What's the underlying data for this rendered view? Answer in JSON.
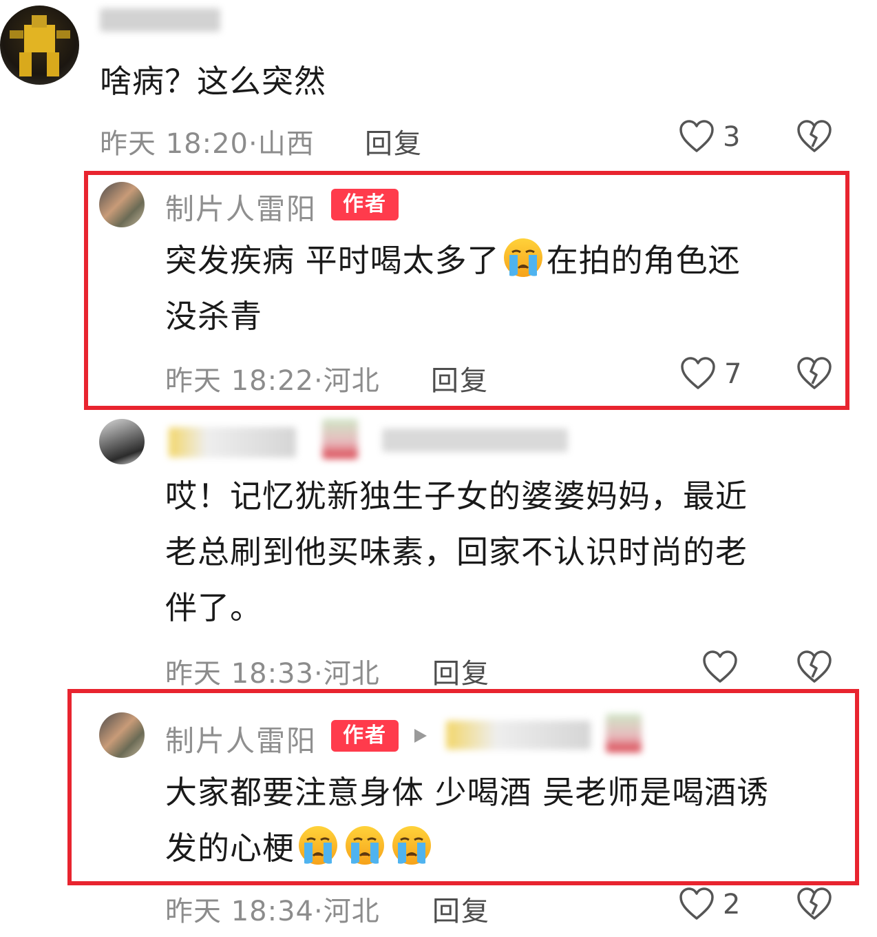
{
  "comments": [
    {
      "text": "啥病？这么突然",
      "time": "昨天 18:20",
      "location": "山西",
      "reply": "回复",
      "likes": "3"
    },
    {
      "username": "制片人雷阳",
      "badge": "作者",
      "text_line1": "突发疾病 平时喝太多了",
      "text_line1b": "在拍的角色还",
      "text_line2": "没杀青",
      "time": "昨天 18:22",
      "location": "河北",
      "reply": "回复",
      "likes": "7"
    },
    {
      "text_line1": "哎！记忆犹新独生子女的婆婆妈妈，最近",
      "text_line2": "老总刷到他买味素，回家不认识时尚的老",
      "text_line3": "伴了。",
      "time": "昨天 18:33",
      "location": "河北",
      "reply": "回复"
    },
    {
      "username": "制片人雷阳",
      "badge": "作者",
      "text_line1": "大家都要注意身体 少喝酒 吴老师是喝酒诱",
      "text_line2": "发的心梗",
      "time": "昨天 18:34",
      "location": "河北",
      "reply": "回复",
      "likes": "2"
    }
  ],
  "colors": {
    "highlight_border": "#e8242f",
    "badge_bg": "#ff3b4c"
  },
  "icons": [
    "heart-outline-icon",
    "broken-heart-icon",
    "crying-face-emoji",
    "play-arrow-icon"
  ]
}
